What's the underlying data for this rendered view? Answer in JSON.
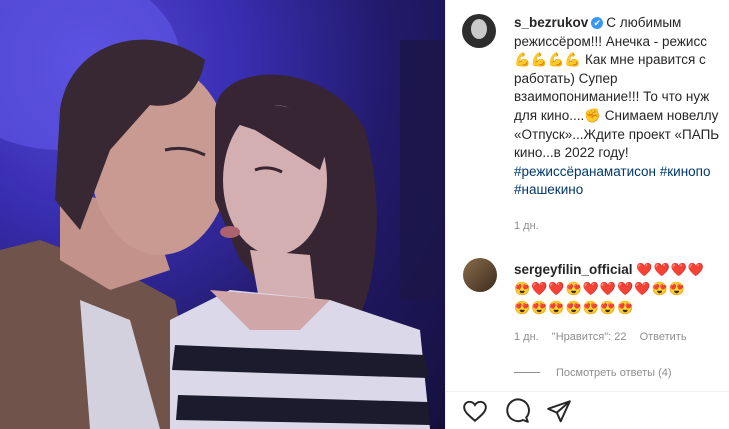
{
  "post": {
    "username": "s_bezrukov",
    "verified_mark": "✔",
    "caption_lines": [
      "С любимым",
      "режиссёром!!! Анечка - режисс",
      "💪💪💪💪 Как мне нравится с",
      "работать) Супер",
      "взаимопонимание!!! То что нуж",
      "для кино....✊ Снимаем новеллу",
      "«Отпуск»...Ждите проект «ПАПЬ",
      "кино...в 2022 году!"
    ],
    "hashtags_line1": "#режиссёранаматисон #кинопо",
    "hashtags_line2": "#нашекино",
    "time": "1 дн."
  },
  "comment": {
    "username": "sergeyfilin_official",
    "emoji_line1": "❤️❤️❤️❤️",
    "emoji_line2": "😍❤️❤️😍❤️❤️❤️❤️😍😍",
    "emoji_line3": "😍😍😍😍😍😍😍",
    "time": "1 дн.",
    "likes": "\"Нравится\": 22",
    "reply": "Ответить",
    "view_replies": "Посмотреть ответы (4)"
  },
  "icons": {
    "like": "heart-icon",
    "comment": "comment-icon",
    "share": "share-icon"
  }
}
